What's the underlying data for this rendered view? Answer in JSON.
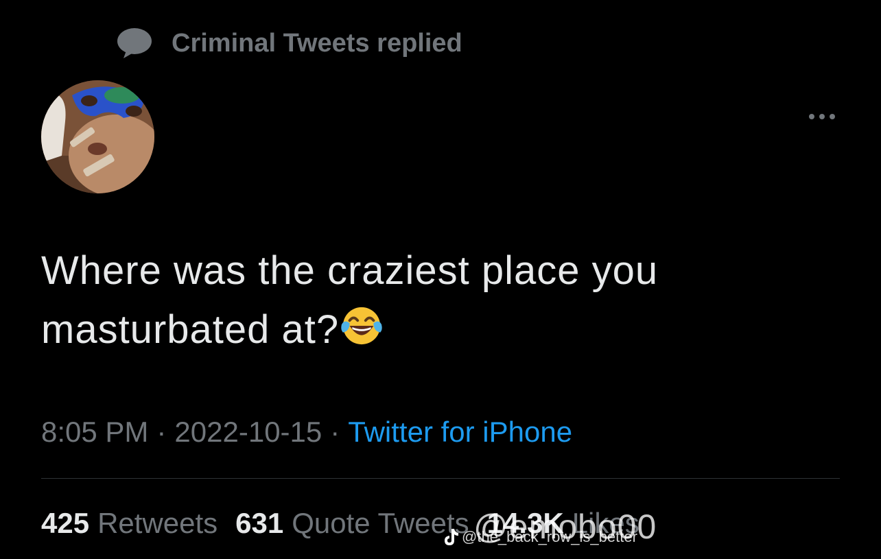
{
  "context": {
    "icon": "speech-bubble-icon",
    "text": "Criminal Tweets replied"
  },
  "avatar": {
    "description_icon": "profile-photo"
  },
  "more_menu": {
    "icon": "more-options-icon"
  },
  "tweet": {
    "text": "Where was the craziest place you masturbated at?",
    "emoji_icon": "face-with-tears-of-joy-icon"
  },
  "meta": {
    "time": "8:05 PM",
    "separator": "·",
    "date": "2022-10-15",
    "source": "Twitter for iPhone"
  },
  "stats": {
    "retweets_count": "425",
    "retweets_label": "Retweets",
    "quotes_count": "631",
    "quotes_label": "Quote Tweets",
    "likes_count": "14.3K",
    "likes_label": "Likes"
  },
  "watermark": {
    "icon": "tiktok-logo-icon",
    "handle_small": "@the_back_row_is_better",
    "handle_large": "@emobo00"
  },
  "colors": {
    "background": "#000000",
    "primary_text": "#e7e9ea",
    "secondary_text": "#71767b",
    "link": "#1d9bf0",
    "divider": "#2f3336"
  }
}
